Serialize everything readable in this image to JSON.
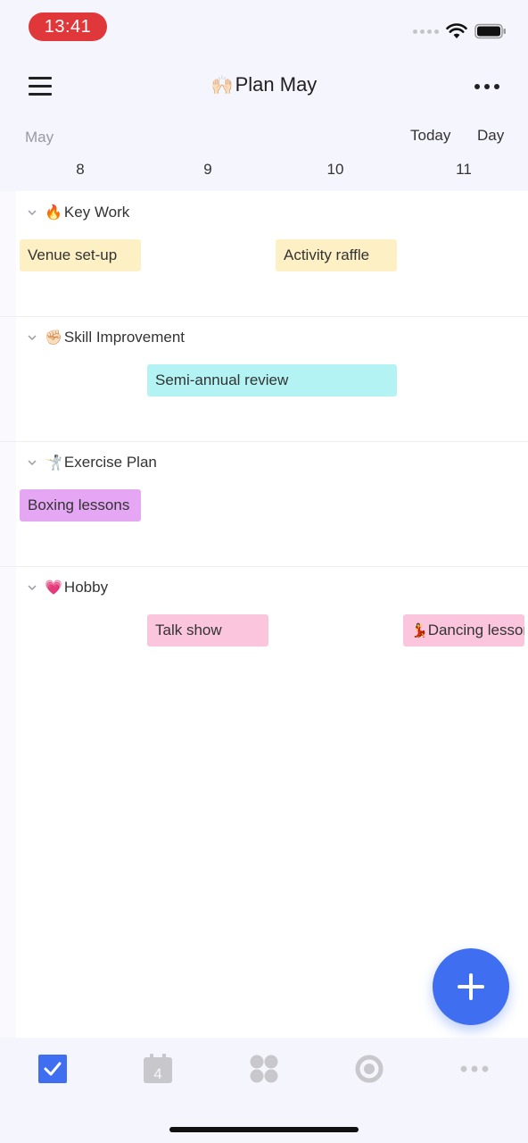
{
  "status": {
    "time": "13:41"
  },
  "header": {
    "title_emoji": "🙌🏻",
    "title": "Plan May"
  },
  "calendar": {
    "month": "May",
    "today_label": "Today",
    "view_label": "Day",
    "days": [
      "8",
      "9",
      "10",
      "11"
    ]
  },
  "sections": [
    {
      "emoji": "🔥",
      "name": "Key Work",
      "tasks": [
        {
          "label": "Venue set-up",
          "color": "#fdf0c4"
        },
        {
          "label": "Activity raffle",
          "color": "#fdf0c4"
        }
      ]
    },
    {
      "emoji": "✊🏻",
      "name": "Skill Improvement",
      "tasks": [
        {
          "label": "Semi-annual review",
          "color": "#b3f3f3"
        }
      ]
    },
    {
      "emoji": "🤺",
      "name": "Exercise Plan",
      "tasks": [
        {
          "label": "Boxing lessons",
          "color": "#e5a6f4"
        }
      ]
    },
    {
      "emoji": "💗",
      "name": "Hobby",
      "tasks": [
        {
          "label": "Talk show",
          "color": "#fbc5dd"
        },
        {
          "emoji": "💃",
          "label": "Dancing lessons",
          "color": "#fbc5dd"
        }
      ]
    }
  ],
  "tabbar": {
    "items": [
      {
        "icon": "checkbox-icon",
        "active": true
      },
      {
        "icon": "calendar-icon",
        "badge": "4"
      },
      {
        "icon": "grid-icon"
      },
      {
        "icon": "focus-icon"
      },
      {
        "icon": "more-icon"
      }
    ]
  },
  "colors": {
    "accent": "#3f6ff0",
    "status_pill": "#e0383a"
  }
}
